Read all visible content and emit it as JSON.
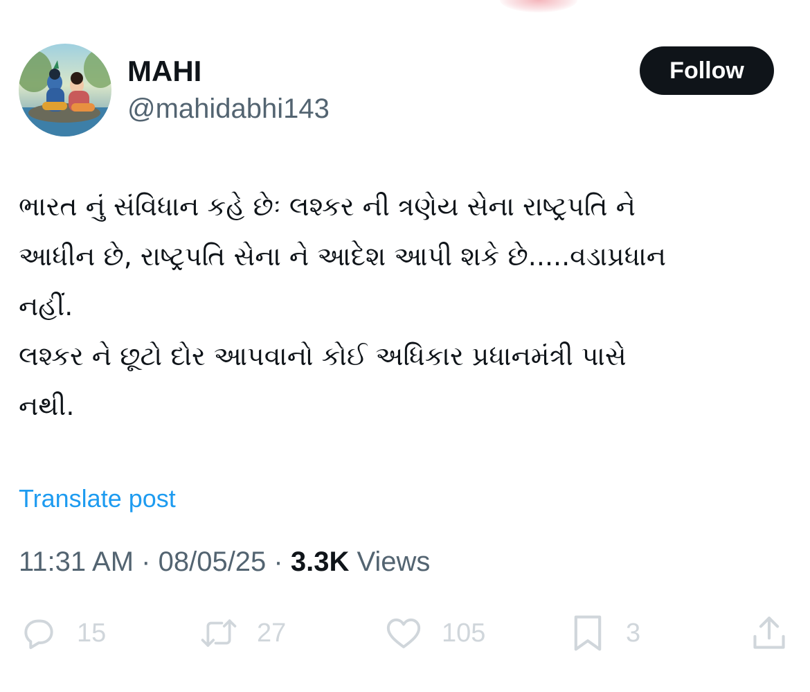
{
  "author": {
    "display_name": "MAHI",
    "handle": "@mahidabhi143",
    "follow_label": "Follow"
  },
  "post": {
    "lines": [
      "ભારત નું સંવિધાન કહે છેઃ લશ્કર ની ત્રણેય સેના રાષ્ટ્રપતિ ને",
      "આધીન છે, રાષ્ટ્રપતિ સેના ને આદેશ આપી શકે છે.....વડાપ્રધાન",
      "નહીં.",
      "લશ્કર ને છૂટો દોર આપવાનો કોઈ અધિકાર પ્રધાનમંત્રી પાસે",
      "નથી."
    ],
    "translate_label": "Translate post"
  },
  "meta": {
    "time": "11:31 AM",
    "separator": " · ",
    "date": "08/05/25",
    "views_count": "3.3K",
    "views_label": " Views"
  },
  "actions": {
    "reply_count": "15",
    "repost_count": "27",
    "like_count": "105",
    "bookmark_count": "3"
  },
  "icons": {
    "reply": "reply-bubble-icon",
    "repost": "repost-arrows-icon",
    "like": "heart-icon",
    "bookmark": "bookmark-icon",
    "share": "share-upload-icon"
  },
  "colors": {
    "text_primary": "#0f1419",
    "text_secondary": "#536471",
    "link": "#1d9bf0",
    "action_muted": "#d0d6db",
    "follow_bg": "#0f1419"
  }
}
